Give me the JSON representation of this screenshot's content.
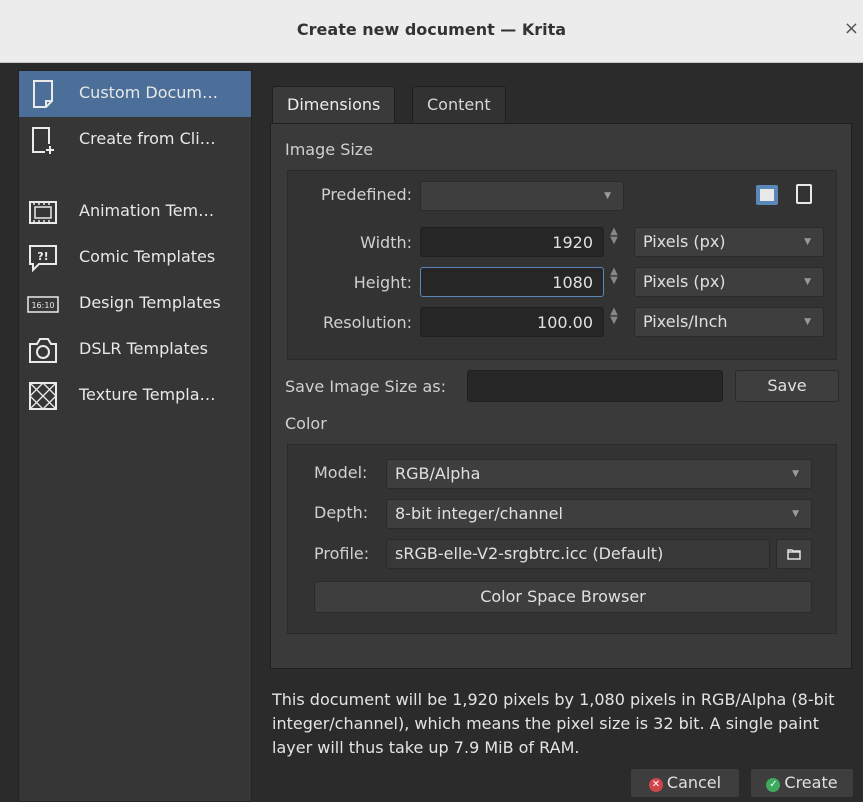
{
  "window": {
    "title": "Create new document — Krita",
    "close_glyph": "×"
  },
  "sidebar": {
    "items": [
      {
        "label": "Custom Docum…",
        "icon": "document-icon",
        "selected": true
      },
      {
        "label": "Create from Cli…",
        "icon": "clipboard-new-icon"
      },
      {
        "label": "Animation Tem…",
        "icon": "animation-icon"
      },
      {
        "label": "Comic Templates",
        "icon": "comic-icon",
        "glyph": "?!"
      },
      {
        "label": "Design Templates",
        "icon": "design-icon",
        "glyph": "16:10"
      },
      {
        "label": "DSLR Templates",
        "icon": "camera-icon"
      },
      {
        "label": "Texture Templa…",
        "icon": "texture-icon"
      }
    ]
  },
  "tabs": {
    "dimensions": "Dimensions",
    "content": "Content"
  },
  "image_size": {
    "heading": "Image Size",
    "predefined_label": "Predefined:",
    "predefined_value": "",
    "width_label": "Width:",
    "width_value": "1920",
    "width_unit": "Pixels (px)",
    "height_label": "Height:",
    "height_value": "1080",
    "height_unit": "Pixels (px)",
    "resolution_label": "Resolution:",
    "resolution_value": "100.00",
    "resolution_unit": "Pixels/Inch",
    "orientation": "landscape"
  },
  "save_size": {
    "label": "Save Image Size as:",
    "value": "",
    "button": "Save"
  },
  "color": {
    "heading": "Color",
    "model_label": "Model:",
    "model_value": "RGB/Alpha",
    "depth_label": "Depth:",
    "depth_value": "8-bit integer/channel",
    "profile_label": "Profile:",
    "profile_value": "sRGB-elle-V2-srgbtrc.icc (Default)",
    "browser_button": "Color Space Browser"
  },
  "description": "This document will be 1,920 pixels by 1,080 pixels in RGB/Alpha (8-bit integer/channel), which means the pixel size is 32 bit. A single paint layer will thus take up 7.9 MiB of RAM.",
  "buttons": {
    "cancel": "Cancel",
    "create": "Create"
  },
  "colors": {
    "selection": "#4b6f98",
    "focus": "#5b86b8",
    "cancel_icon": "#d0454a",
    "create_icon": "#3daa5c"
  }
}
